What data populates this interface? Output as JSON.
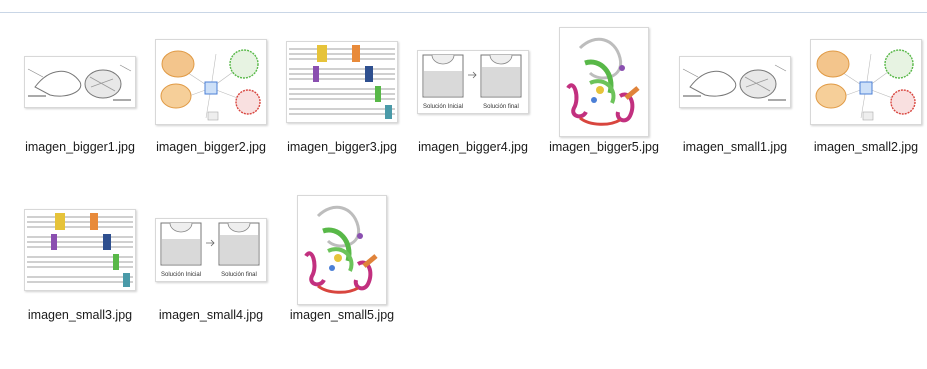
{
  "files": [
    {
      "name": "imagen_bigger1.jpg",
      "kind": "diagram-sketch"
    },
    {
      "name": "imagen_bigger2.jpg",
      "kind": "network-diagram"
    },
    {
      "name": "imagen_bigger3.jpg",
      "kind": "sequence-alignment"
    },
    {
      "name": "imagen_bigger4.jpg",
      "kind": "solution-beakers",
      "captions": [
        "Solución Inicial",
        "Solución final"
      ]
    },
    {
      "name": "imagen_bigger5.jpg",
      "kind": "protein-structure"
    },
    {
      "name": "imagen_small1.jpg",
      "kind": "diagram-sketch"
    },
    {
      "name": "imagen_small2.jpg",
      "kind": "network-diagram"
    },
    {
      "name": "imagen_small3.jpg",
      "kind": "sequence-alignment"
    },
    {
      "name": "imagen_small4.jpg",
      "kind": "solution-beakers",
      "captions": [
        "Solución Inicial",
        "Solución final"
      ]
    },
    {
      "name": "imagen_small5.jpg",
      "kind": "protein-structure"
    }
  ],
  "colors": {
    "selection_line": "#c9d6e6",
    "orange": "#f0a64a",
    "green": "#58b848",
    "blue": "#4b7fd6",
    "red": "#d8453e",
    "magenta": "#c2307f",
    "yellow": "#e6c33a",
    "purple": "#8a4fb0",
    "teal": "#4a9aa8"
  }
}
